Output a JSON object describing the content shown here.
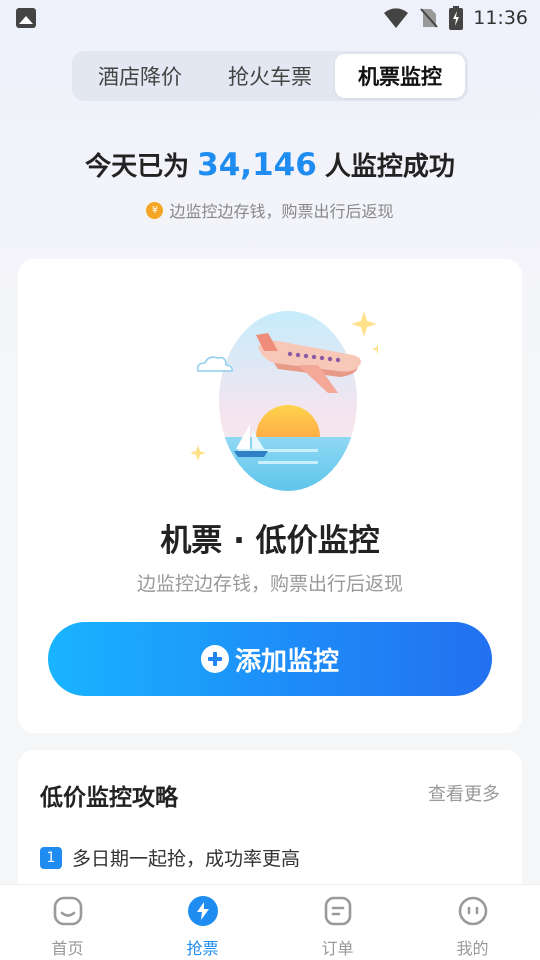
{
  "status_bar": {
    "time": "11:36"
  },
  "tabs": [
    {
      "label": "酒店降价",
      "active": false
    },
    {
      "label": "抢火车票",
      "active": false
    },
    {
      "label": "机票监控",
      "active": true
    }
  ],
  "headline": {
    "prefix": "今天已为",
    "count": "34,146",
    "suffix": "人监控成功"
  },
  "subline": {
    "coin_icon": "coin-icon",
    "coin_glyph": "¥",
    "text": "边监控边存钱，购票出行后返现"
  },
  "card": {
    "title": "机票 · 低价监控",
    "subtitle": "边监控边存钱，购票出行后返现",
    "add_button": "添加监控"
  },
  "guide": {
    "title": "低价监控攻略",
    "more": "查看更多",
    "items": [
      {
        "num": "1",
        "text": "多日期一起抢，成功率更高"
      }
    ]
  },
  "nav": [
    {
      "label": "首页",
      "icon": "home-face-icon",
      "active": false
    },
    {
      "label": "抢票",
      "icon": "lightning-icon",
      "active": true
    },
    {
      "label": "订单",
      "icon": "order-icon",
      "active": false
    },
    {
      "label": "我的",
      "icon": "profile-face-icon",
      "active": false
    }
  ],
  "colors": {
    "accent": "#1e8cf0",
    "button_start": "#19b4ff",
    "button_end": "#2370f0"
  }
}
